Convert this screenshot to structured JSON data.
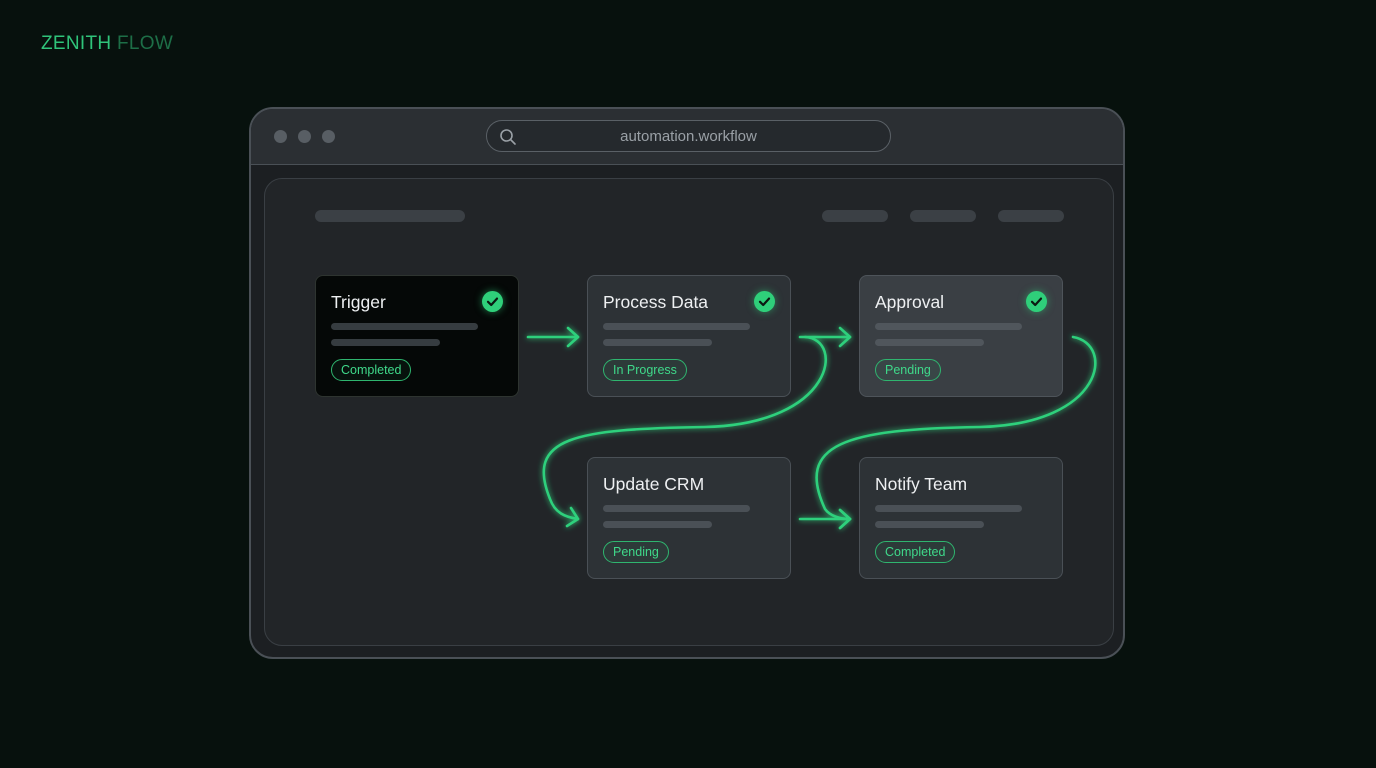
{
  "brand": {
    "part1": "ZENITH",
    "part2": "FLOW"
  },
  "browser": {
    "address": "automation.workflow",
    "search_icon": "search-icon"
  },
  "workflow": {
    "nodes": [
      {
        "title": "Trigger",
        "status": "Completed",
        "checked": true
      },
      {
        "title": "Process Data",
        "status": "In Progress",
        "checked": true
      },
      {
        "title": "Approval",
        "status": "Pending",
        "checked": true
      },
      {
        "title": "Update CRM",
        "status": "Pending",
        "checked": false
      },
      {
        "title": "Notify Team",
        "status": "Completed",
        "checked": false
      }
    ]
  },
  "colors": {
    "accent": "#2fcf7a",
    "background": "#07110d",
    "window": "#1c1f22"
  }
}
